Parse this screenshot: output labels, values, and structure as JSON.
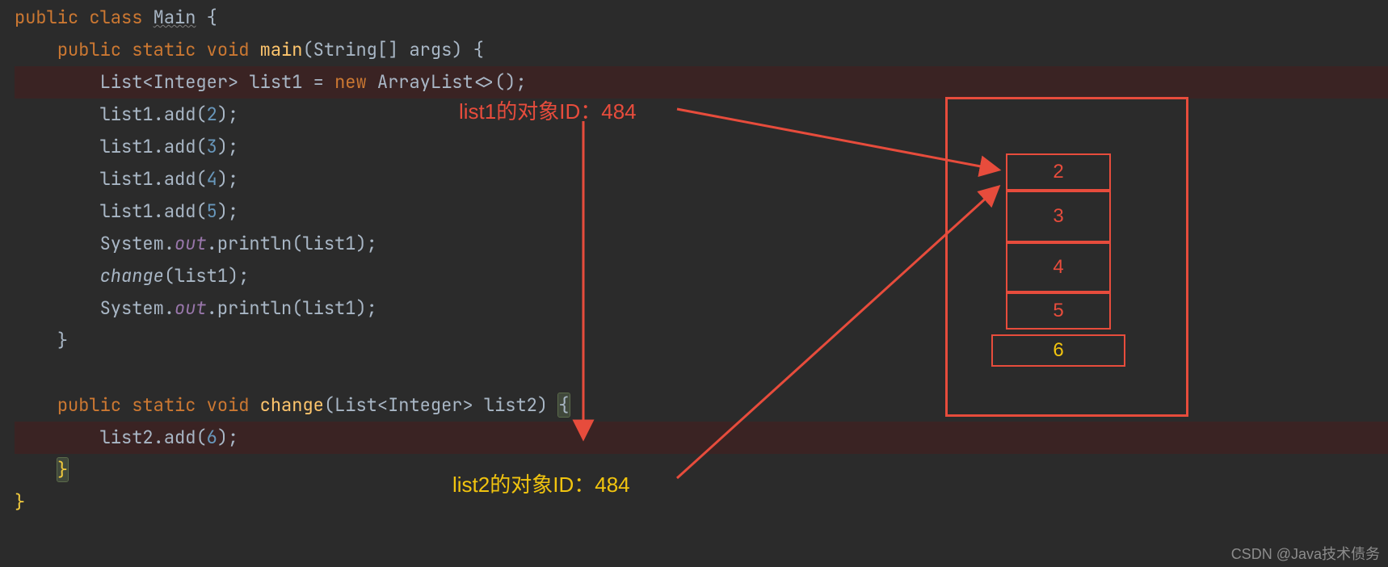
{
  "code": {
    "l01": "public class Main {",
    "l02": "    public static void main(String[] args) {",
    "l03": "        List<Integer> list1 = new ArrayList<>();",
    "l04": "        list1.add(2);",
    "l05": "        list1.add(3);",
    "l06": "        list1.add(4);",
    "l07": "        list1.add(5);",
    "l08": "        System.out.println(list1);",
    "l09": "        change(list1);",
    "l10": "        System.out.println(list1);",
    "l11": "    }",
    "l12": "",
    "l13": "    public static void change(List<Integer> list2) {",
    "l14": "        list2.add(6);",
    "l15": "    }",
    "l16": "}",
    "nums": {
      "two": "2",
      "three": "3",
      "four": "4",
      "five": "5",
      "six": "6"
    },
    "kw": {
      "public": "public",
      "class": "class",
      "static": "static",
      "void": "void",
      "new": "new"
    },
    "names": {
      "Main": "Main",
      "main": "main",
      "String": "String",
      "args": "args",
      "List": "List",
      "Integer": "Integer",
      "list1": "list1",
      "ArrayList": "ArrayList",
      "add": "add",
      "System": "System",
      "out": "out",
      "println": "println",
      "change": "change",
      "list2": "list2"
    }
  },
  "annotations": {
    "list1_label": "list1的对象ID：484",
    "list2_label": "list2的对象ID：484"
  },
  "diagram": {
    "cells": [
      "2",
      "3",
      "4",
      "5",
      "6"
    ]
  },
  "watermark": "CSDN @Java技术债务"
}
